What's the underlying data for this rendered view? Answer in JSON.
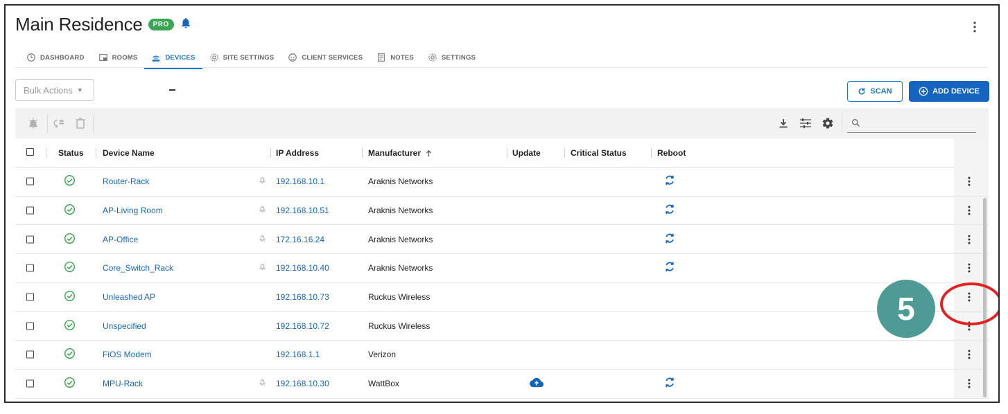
{
  "header": {
    "title": "Main Residence",
    "badge": "PRO",
    "accent": "#1976d2",
    "badge_color": "#3aa655"
  },
  "tabs": [
    {
      "label": "DASHBOARD",
      "icon": "clock-icon",
      "active": false
    },
    {
      "label": "ROOMS",
      "icon": "rooms-icon",
      "active": false
    },
    {
      "label": "DEVICES",
      "icon": "router-icon",
      "active": true
    },
    {
      "label": "SITE SETTINGS",
      "icon": "gear-icon",
      "active": false
    },
    {
      "label": "CLIENT SERVICES",
      "icon": "support-icon",
      "active": false
    },
    {
      "label": "NOTES",
      "icon": "notes-icon",
      "active": false
    },
    {
      "label": "SETTINGS",
      "icon": "gear-icon",
      "active": false
    }
  ],
  "actions": {
    "bulk_label": "Bulk Actions",
    "scan_label": "SCAN",
    "add_label": "ADD DEVICE"
  },
  "table": {
    "headers": {
      "status": "Status",
      "device_name": "Device Name",
      "ip": "IP Address",
      "manufacturer": "Manufacturer",
      "update": "Update",
      "critical": "Critical Status",
      "reboot": "Reboot"
    },
    "rows": [
      {
        "name": "Router-Rack",
        "ip": "192.168.10.1",
        "manufacturer": "Araknis Networks",
        "bell": true,
        "update": false,
        "reboot": true
      },
      {
        "name": "AP-Living Room",
        "ip": "192.168.10.51",
        "manufacturer": "Araknis Networks",
        "bell": true,
        "update": false,
        "reboot": true
      },
      {
        "name": "AP-Office",
        "ip": "172.16.16.24",
        "manufacturer": "Araknis Networks",
        "bell": true,
        "update": false,
        "reboot": true
      },
      {
        "name": "Core_Switch_Rack",
        "ip": "192.168.10.40",
        "manufacturer": "Araknis Networks",
        "bell": true,
        "update": false,
        "reboot": true
      },
      {
        "name": "Unleashed AP",
        "ip": "192.168.10.73",
        "manufacturer": "Ruckus Wireless",
        "bell": false,
        "update": false,
        "reboot": false
      },
      {
        "name": "Unspecified",
        "ip": "192.168.10.72",
        "manufacturer": "Ruckus Wireless",
        "bell": false,
        "update": false,
        "reboot": false
      },
      {
        "name": "FiOS Modem",
        "ip": "192.168.1.1",
        "manufacturer": "Verizon",
        "bell": false,
        "update": false,
        "reboot": false
      },
      {
        "name": "MPU-Rack",
        "ip": "192.168.10.30",
        "manufacturer": "WattBox",
        "bell": true,
        "update": true,
        "reboot": true
      }
    ]
  },
  "annotation": {
    "step": "5"
  }
}
